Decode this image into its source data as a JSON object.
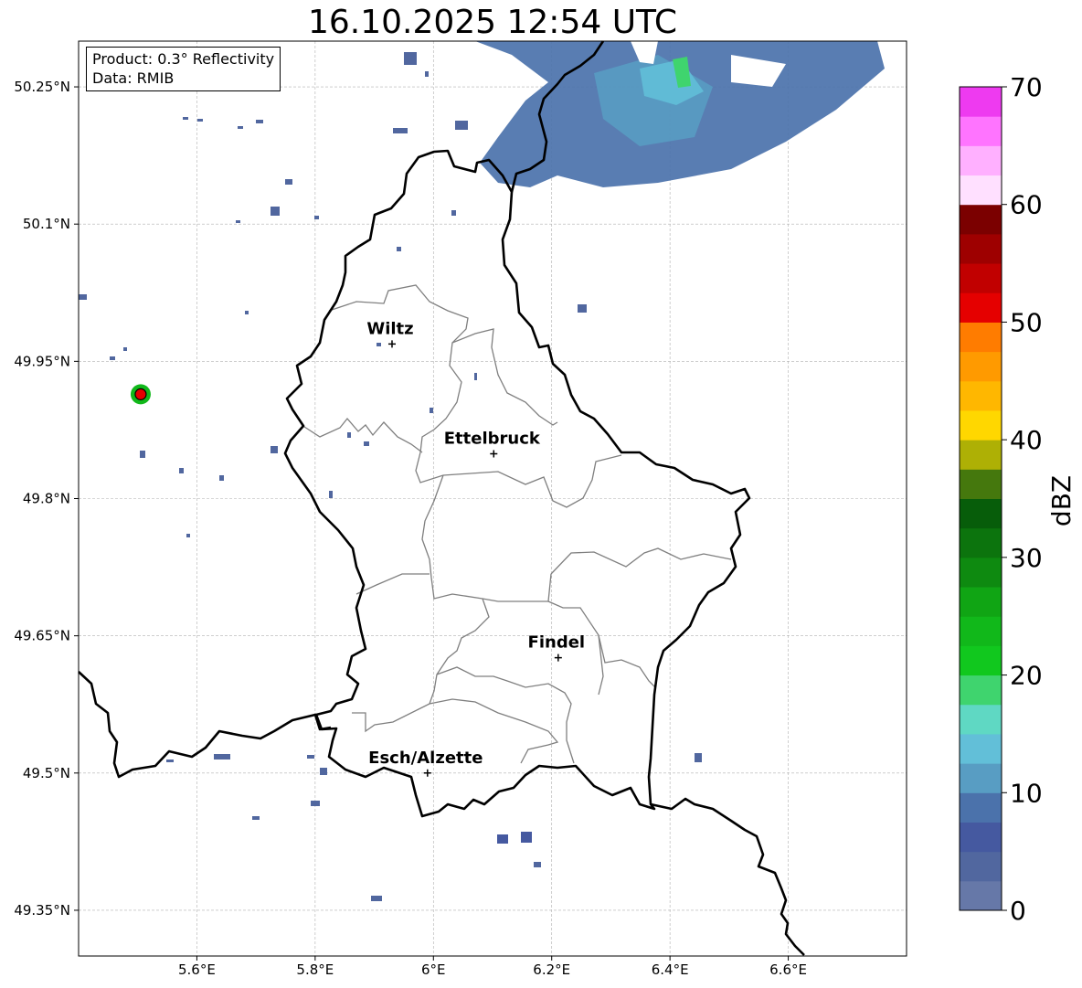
{
  "title": "16.10.2025 12:54 UTC",
  "info": {
    "product": "Product: 0.3° Reflectivity",
    "data": "Data: RMIB"
  },
  "lon_ticks": [
    {
      "value": 5.6,
      "label": "5.6°E"
    },
    {
      "value": 5.8,
      "label": "5.8°E"
    },
    {
      "value": 6.0,
      "label": "6°E"
    },
    {
      "value": 6.2,
      "label": "6.2°E"
    },
    {
      "value": 6.4,
      "label": "6.4°E"
    },
    {
      "value": 6.6,
      "label": "6.6°E"
    }
  ],
  "lat_ticks": [
    {
      "value": 50.25,
      "label": "50.25°N"
    },
    {
      "value": 50.1,
      "label": "50.1°N"
    },
    {
      "value": 49.95,
      "label": "49.95°N"
    },
    {
      "value": 49.8,
      "label": "49.8°N"
    },
    {
      "value": 49.65,
      "label": "49.65°N"
    },
    {
      "value": 49.5,
      "label": "49.5°N"
    },
    {
      "value": 49.35,
      "label": "49.35°N"
    }
  ],
  "extent": {
    "lon_min": 5.4,
    "lon_max": 6.8,
    "lat_min": 49.3,
    "lat_max": 50.3
  },
  "cities": [
    {
      "name": "Wiltz",
      "lon": 5.93,
      "lat": 49.969
    },
    {
      "name": "Ettelbruck",
      "lon": 6.102,
      "lat": 49.849
    },
    {
      "name": "Findel",
      "lon": 6.211,
      "lat": 49.626
    },
    {
      "name": "Esch/Alzette",
      "lon": 5.99,
      "lat": 49.5
    }
  ],
  "radar_site": {
    "lon": 5.505,
    "lat": 49.914
  },
  "colorbar": {
    "label": "dBZ",
    "min": 0,
    "max": 70,
    "ticks": [
      0,
      10,
      20,
      30,
      40,
      50,
      60,
      70
    ],
    "colors": [
      "#6678a8",
      "#51679f",
      "#4559a0",
      "#4b72ab",
      "#589dc3",
      "#62bfd8",
      "#5fd8c3",
      "#3fd46e",
      "#11c81e",
      "#11b81a",
      "#10a514",
      "#0e8a10",
      "#0c740d",
      "#075d0a",
      "#45780d",
      "#aeb005",
      "#ffd700",
      "#ffb700",
      "#ff9a00",
      "#ff7c00",
      "#e50000",
      "#c10000",
      "#9e0000",
      "#7b0000",
      "#ffe0ff",
      "#ffb0ff",
      "#ff74ff",
      "#ee3af0"
    ]
  }
}
